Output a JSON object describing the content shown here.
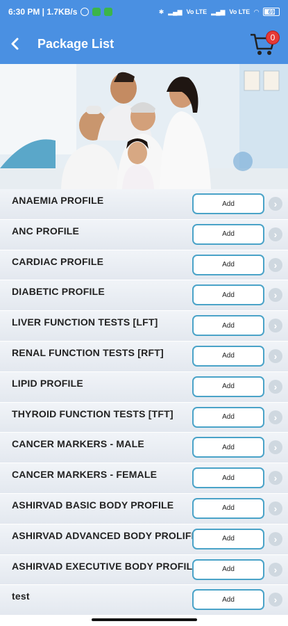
{
  "status_bar": {
    "time_speed": "6:30 PM | 1.7KB/s",
    "signal_labels": [
      "Vo LTE",
      "Vo LTE"
    ],
    "battery": "69"
  },
  "header": {
    "back_icon": "back-arrow-icon",
    "title": "Package List",
    "cart_icon": "shopping-cart-icon",
    "cart_count": "0"
  },
  "banner": {
    "image": "family-photo"
  },
  "packages": [
    {
      "name": "ANAEMIA PROFILE",
      "button": "Add"
    },
    {
      "name": "ANC PROFILE",
      "button": "Add"
    },
    {
      "name": "CARDIAC PROFILE",
      "button": "Add"
    },
    {
      "name": "DIABETIC PROFILE",
      "button": "Add"
    },
    {
      "name": "LIVER FUNCTION TESTS [LFT]",
      "button": "Add"
    },
    {
      "name": "RENAL FUNCTION TESTS [RFT]",
      "button": "Add"
    },
    {
      "name": "LIPID PROFILE",
      "button": "Add"
    },
    {
      "name": "THYROID FUNCTION TESTS [TFT]",
      "button": "Add"
    },
    {
      "name": "CANCER MARKERS - MALE",
      "button": "Add"
    },
    {
      "name": "CANCER MARKERS - FEMALE",
      "button": "Add"
    },
    {
      "name": "ASHIRVAD BASIC BODY PROFILE",
      "button": "Add"
    },
    {
      "name": "ASHIRVAD ADVANCED BODY PROLIFE",
      "button": "Add"
    },
    {
      "name": "ASHIRVAD EXECUTIVE  BODY PROFILE",
      "button": "Add"
    },
    {
      "name": "test",
      "button": "Add"
    }
  ],
  "colors": {
    "primary": "#4a90e2",
    "button_border": "#4aa3c8",
    "badge": "#e53935"
  }
}
